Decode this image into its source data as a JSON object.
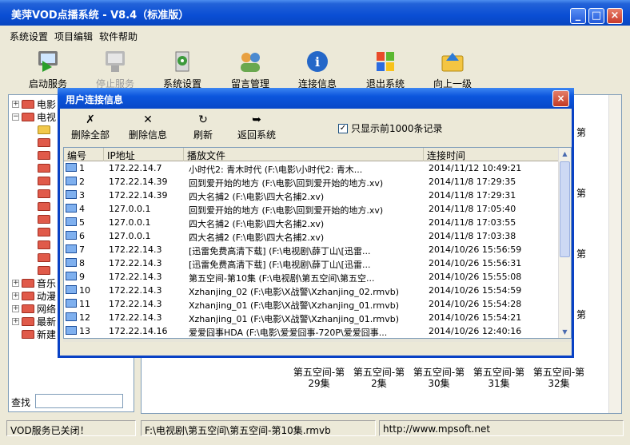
{
  "window": {
    "title": "美萍VOD点播系统 - V8.4（标准版）"
  },
  "menu": [
    "系统设置",
    "项目编辑",
    "软件帮助"
  ],
  "toolbar": [
    {
      "label": "启动服务",
      "icon": "start-service-icon",
      "disabled": false
    },
    {
      "label": "停止服务",
      "icon": "stop-service-icon",
      "disabled": true
    },
    {
      "label": "系统设置",
      "icon": "settings-icon",
      "disabled": false
    },
    {
      "label": "留言管理",
      "icon": "messages-icon",
      "disabled": false
    },
    {
      "label": "连接信息",
      "icon": "info-icon",
      "disabled": false
    },
    {
      "label": "退出系统",
      "icon": "exit-icon",
      "disabled": false
    },
    {
      "label": "向上一级",
      "icon": "folder-up-icon",
      "disabled": false
    }
  ],
  "tree": [
    {
      "label": "电影",
      "expanded": false
    },
    {
      "label": "电视",
      "expanded": true
    },
    {
      "label": "音乐",
      "expanded": false
    },
    {
      "label": "动漫",
      "expanded": false
    },
    {
      "label": "网络",
      "expanded": false
    },
    {
      "label": "最新",
      "expanded": false
    },
    {
      "label": "新建",
      "expanded": null
    }
  ],
  "search": {
    "label": "查找",
    "value": ""
  },
  "episodes": {
    "rows": [
      {
        "line1": "第五空间-第",
        "line2": "29集"
      },
      {
        "line1": "第五空间-第",
        "line2": "2集"
      },
      {
        "line1": "第五空间-第",
        "line2": "30集"
      },
      {
        "line1": "第五空间-第",
        "line2": "31集"
      },
      {
        "line1": "第五空间-第",
        "line2": "32集"
      }
    ],
    "partial_label": "第"
  },
  "status": {
    "service": "VOD服务已关闭！",
    "file": "F:\\电视剧\\第五空间\\第五空间-第10集.rmvb",
    "url": "http://www.mpsoft.net"
  },
  "dialog": {
    "title": "用户连接信息",
    "close": "×",
    "tools": [
      {
        "label": "删除全部",
        "icon": "delete-all-icon",
        "glyph": "✗"
      },
      {
        "label": "删除信息",
        "icon": "delete-icon",
        "glyph": "✕"
      },
      {
        "label": "刷新",
        "icon": "refresh-icon",
        "glyph": "↻"
      },
      {
        "label": "返回系统",
        "icon": "return-icon",
        "glyph": "➥"
      }
    ],
    "only1000": {
      "label": "只显示前1000条记录",
      "checked": true
    },
    "columns": [
      "编号",
      "IP地址",
      "播放文件",
      "连接时间"
    ],
    "rows": [
      [
        "1",
        "172.22.14.7",
        "小时代2: 青木时代    (F:\\电影\\小时代2: 青木...",
        "2014/11/12 10:49:21"
      ],
      [
        "2",
        "172.22.14.39",
        "回到爱开始的地方    (F:\\电影\\回到爱开始的地方.xv)",
        "2014/11/8 17:29:35"
      ],
      [
        "3",
        "172.22.14.39",
        "四大名捕2    (F:\\电影\\四大名捕2.xv)",
        "2014/11/8 17:29:31"
      ],
      [
        "4",
        "127.0.0.1",
        "回到爱开始的地方    (F:\\电影\\回到爱开始的地方.xv)",
        "2014/11/8 17:05:40"
      ],
      [
        "5",
        "127.0.0.1",
        "四大名捕2    (F:\\电影\\四大名捕2.xv)",
        "2014/11/8 17:03:55"
      ],
      [
        "6",
        "127.0.0.1",
        "四大名捕2    (F:\\电影\\四大名捕2.xv)",
        "2014/11/8 17:03:38"
      ],
      [
        "7",
        "172.22.14.3",
        "[迅雷免费高清下载]    (F:\\电视剧\\薛丁山\\[迅雷...",
        "2014/10/26 15:56:59"
      ],
      [
        "8",
        "172.22.14.3",
        "[迅雷免费高清下载]    (F:\\电视剧\\薛丁山\\[迅雷...",
        "2014/10/26 15:56:31"
      ],
      [
        "9",
        "172.22.14.3",
        "第五空间-第10集    (F:\\电视剧\\第五空间\\第五空...",
        "2014/10/26 15:55:08"
      ],
      [
        "10",
        "172.22.14.3",
        "Xzhanjing_02    (F:\\电影\\X战警\\Xzhanjing_02.rmvb)",
        "2014/10/26 15:54:59"
      ],
      [
        "11",
        "172.22.14.3",
        "Xzhanjing_01    (F:\\电影\\X战警\\Xzhanjing_01.rmvb)",
        "2014/10/26 15:54:28"
      ],
      [
        "12",
        "172.22.14.3",
        "Xzhanjing_01    (F:\\电影\\X战警\\Xzhanjing_01.rmvb)",
        "2014/10/26 15:54:21"
      ],
      [
        "13",
        "172.22.14.16",
        "爱爱囧事HDA    (F:\\电影\\爱爱囧事-720P\\爱爱囧事...",
        "2014/10/26 12:40:16"
      ]
    ]
  }
}
